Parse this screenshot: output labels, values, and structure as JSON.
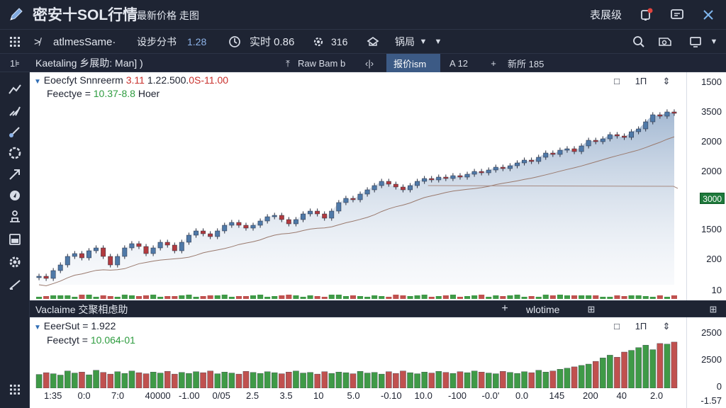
{
  "titlebar": {
    "app_title": "密安十SOL行情",
    "subtitle": "最新价格 走图",
    "right_label": "表展级"
  },
  "toolbar": {
    "symbol": "atlmesSame·",
    "interval_label": "设步分书",
    "interval_value": "1.28",
    "realtime_label": "实时 0.86",
    "indicator_count": "316",
    "layout_label": "锅局"
  },
  "subbar": {
    "left_label": "Kaetaling 乡展助: Man] )",
    "tabs": [
      {
        "label": "Raw Bam b"
      },
      {
        "label": "‹|›"
      },
      {
        "label": "报价ism"
      },
      {
        "label": "A 12"
      },
      {
        "label": "新所 185"
      }
    ]
  },
  "main_legend": {
    "line1_prefix": "Eoecfyt Snnreerm",
    "line1_val_a": "3.11",
    "line1_val_b": "1.22.500.",
    "line1_val_c": "0S-11.00",
    "line2_prefix": "Feectye =",
    "line2_val": "10.37-8.8",
    "line2_suffix": "Hoer",
    "controls": [
      "□",
      "1П",
      "⇕"
    ]
  },
  "divider": {
    "label": "Vaclaime 交聚相虑助",
    "mid_label": "wlotime"
  },
  "lower_legend": {
    "line1_prefix": "EeerSut =",
    "line1_val": "1.922",
    "line2_prefix": "Feectyt =",
    "line2_val": "10.064-01",
    "controls": [
      "□",
      "1П",
      "⇕"
    ]
  },
  "main_axis_ticks": [
    "1500",
    "3500",
    "2000",
    "2000",
    "1500",
    "200",
    "10"
  ],
  "main_axis_badge": "3000",
  "lower_axis_ticks": [
    "2500",
    "2500",
    "0",
    "-1.57"
  ],
  "x_axis_labels": [
    "1:35",
    "0:0",
    "7:0",
    "40000",
    "-1.00",
    "0/05",
    "2.5",
    "3.5",
    "10",
    "5.0",
    "-0.10",
    "10.0",
    "-100",
    "-0.0'",
    "0.0",
    "145",
    "200",
    "40",
    "2.0"
  ],
  "colors": {
    "up": "#4f79a8",
    "down": "#b23a3f",
    "vol_up": "#3f9a47",
    "vol_down": "#c0514f",
    "area_top": "#a9bcd4",
    "ma_line": "#9a7a6e",
    "flat_line": "#a78a82",
    "accent_green": "#2e9c3f",
    "accent_red": "#c9302c",
    "accent_blue": "#2f6db5"
  },
  "chart_data": [
    {
      "type": "candlestick",
      "name": "price",
      "x": [
        0,
        1,
        2,
        3,
        4,
        5,
        6,
        7,
        8,
        9,
        10,
        11,
        12,
        13,
        14,
        15,
        16,
        17,
        18,
        19,
        20,
        21,
        22,
        23,
        24,
        25,
        26,
        27,
        28,
        29,
        30,
        31,
        32,
        33,
        34,
        35,
        36,
        37,
        38,
        39,
        40,
        41,
        42,
        43,
        44,
        45,
        46,
        47,
        48,
        49,
        50,
        51,
        52,
        53,
        54,
        55,
        56,
        57,
        58,
        59,
        60,
        61,
        62,
        63,
        64,
        65,
        66,
        67,
        68,
        69,
        70,
        71,
        72,
        73,
        74,
        75,
        76,
        77,
        78,
        79,
        80,
        81,
        82,
        83,
        84,
        85,
        86,
        87,
        88,
        89
      ],
      "close": [
        560,
        545,
        600,
        640,
        700,
        720,
        690,
        740,
        760,
        700,
        640,
        700,
        760,
        790,
        770,
        720,
        760,
        800,
        780,
        740,
        800,
        850,
        880,
        860,
        840,
        880,
        920,
        940,
        920,
        900,
        920,
        950,
        980,
        990,
        960,
        930,
        960,
        1000,
        1020,
        1000,
        970,
        1020,
        1080,
        1110,
        1100,
        1140,
        1170,
        1200,
        1230,
        1210,
        1190,
        1170,
        1200,
        1230,
        1250,
        1240,
        1260,
        1250,
        1270,
        1260,
        1280,
        1300,
        1290,
        1310,
        1330,
        1320,
        1340,
        1360,
        1380,
        1370,
        1400,
        1430,
        1420,
        1450,
        1460,
        1440,
        1480,
        1520,
        1510,
        1530,
        1560,
        1550,
        1540,
        1580,
        1600,
        1650,
        1700,
        1690,
        1720,
        1710
      ]
    },
    {
      "type": "bar",
      "name": "volume",
      "values": [
        40,
        45,
        42,
        38,
        50,
        44,
        47,
        39,
        52,
        46,
        41,
        48,
        43,
        50,
        45,
        42,
        47,
        44,
        49,
        41,
        46,
        43,
        48,
        45,
        50,
        42,
        47,
        44,
        41,
        49,
        46,
        43,
        48,
        45,
        42,
        47,
        50,
        44,
        46,
        41,
        48,
        43,
        47,
        45,
        42,
        49,
        44,
        46,
        41,
        48,
        43,
        50,
        45,
        42,
        47,
        44,
        49,
        46,
        43,
        48,
        45,
        50,
        47,
        44,
        42,
        49,
        46,
        43,
        48,
        45,
        52,
        47,
        50,
        55,
        58,
        62,
        66,
        70,
        78,
        88,
        96,
        90,
        105,
        110,
        118,
        125,
        112,
        130,
        128,
        134
      ]
    }
  ]
}
